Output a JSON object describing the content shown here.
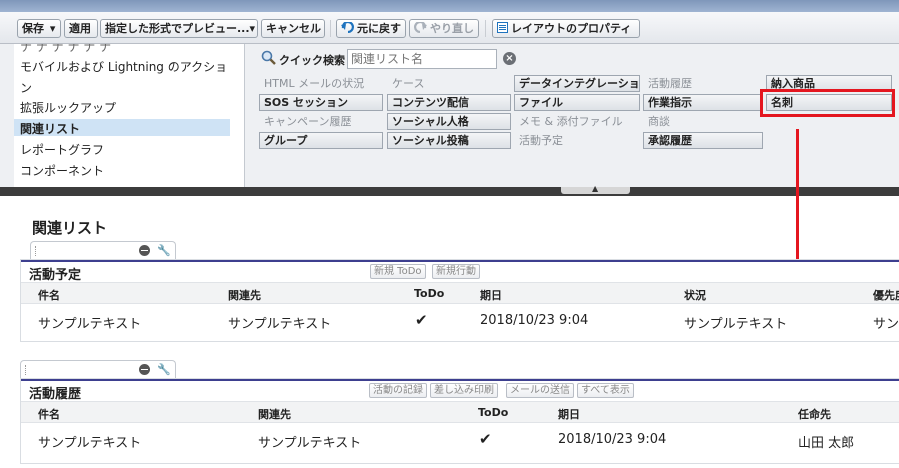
{
  "toolbar": {
    "save": "保存",
    "apply": "適用",
    "preview": "指定した形式でプレビュー...",
    "cancel": "キャンセル",
    "undo": "元に戻す",
    "redo": "やり直し",
    "layout_props": "レイアウトのプロパティ"
  },
  "left_menu": {
    "items": [
      "モバイルおよび Lightning のアクショ",
      "ン",
      "拡張ルックアップ",
      "関連リスト",
      "レポートグラフ",
      "コンポーネント"
    ],
    "selected": "関連リスト"
  },
  "quick_search": {
    "label": "クイック検索",
    "placeholder": "関連リスト名"
  },
  "palette": {
    "cells": [
      [
        "HTML メールの状況",
        "ケース",
        "データインテグレーション",
        "活動履歴",
        "納入商品"
      ],
      [
        "SOS セッション",
        "コンテンツ配信",
        "ファイル",
        "作業指示",
        "名刺"
      ],
      [
        "キャンペーン履歴",
        "ソーシャル人格",
        "メモ & 添付ファイル",
        "商談",
        ""
      ],
      [
        "グループ",
        "ソーシャル投稿",
        "活動予定",
        "承認履歴",
        ""
      ]
    ],
    "bold": [
      [
        false,
        false,
        true,
        false,
        true
      ],
      [
        true,
        true,
        true,
        true,
        true
      ],
      [
        false,
        true,
        false,
        false,
        false
      ],
      [
        true,
        true,
        false,
        true,
        false
      ]
    ],
    "highlighted": "名刺"
  },
  "page_title": "関連リスト",
  "section1": {
    "title": "活動予定",
    "buttons": [
      "新規 ToDo",
      "新規行動"
    ],
    "columns": [
      "件名",
      "関連先",
      "ToDo",
      "期日",
      "状況",
      "優先度"
    ],
    "row": [
      "サンプルテキスト",
      "サンプルテキスト",
      "✔",
      "2018/10/23 9:04",
      "サンプルテキスト",
      "サンプ"
    ]
  },
  "section2": {
    "title": "活動履歴",
    "buttons": [
      "活動の記録",
      "差し込み印刷",
      "メールの送信",
      "すべて表示"
    ],
    "columns": [
      "件名",
      "関連先",
      "ToDo",
      "期日",
      "任命先"
    ],
    "row": [
      "サンプルテキスト",
      "サンプルテキスト",
      "✔",
      "2018/10/23 9:04",
      "山田 太郎"
    ]
  },
  "colors": {
    "accent_border": "#e4161f",
    "section_bar": "#3d3f8f",
    "selected_bg": "#cfe3f5"
  }
}
